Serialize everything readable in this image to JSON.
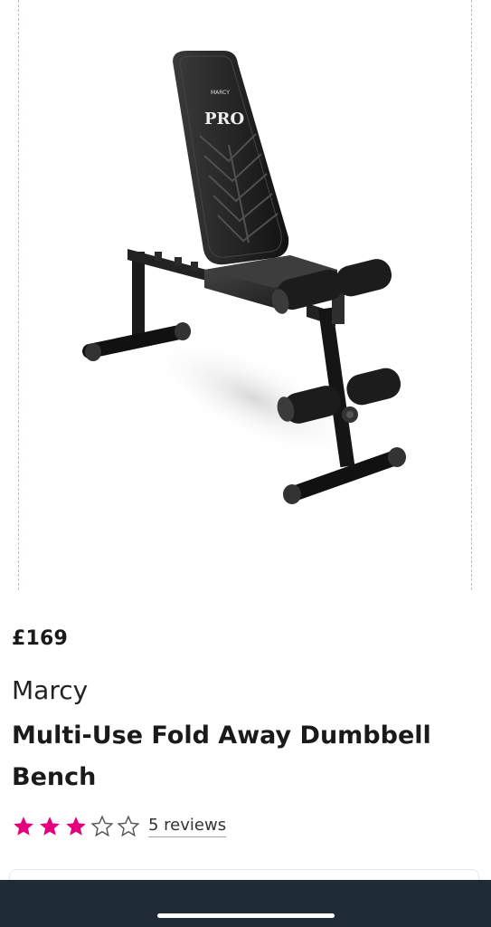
{
  "product": {
    "image_alt": "Marcy Pro weight bench",
    "logo_text": "PRO",
    "logo_brand": "MARCY",
    "price": "£169",
    "brand": "Marcy",
    "title": "Multi-Use Fold Away Dumbbell Bench",
    "rating": {
      "filled_stars": 3,
      "total_stars": 5,
      "reviews_label": "5 reviews",
      "star_color": "#e5007d"
    }
  },
  "colors": {
    "frame_border": "#b5bfd1",
    "bottom_bar": "#1f2c37"
  }
}
